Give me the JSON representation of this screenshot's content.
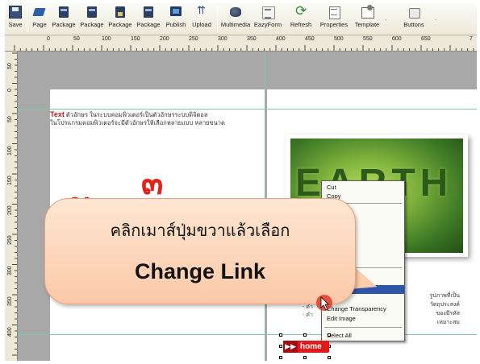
{
  "toolbar": {
    "buttons": [
      {
        "label": "Save",
        "icon": "save-icon"
      },
      {
        "label": "Page",
        "icon": "page-icon"
      },
      {
        "label": "Package",
        "icon": "package-icon"
      },
      {
        "label": "Package",
        "icon": "package-icon"
      },
      {
        "label": "Package",
        "icon": "package-lock-icon"
      },
      {
        "label": "Package",
        "icon": "package-icon"
      },
      {
        "label": "Publish",
        "icon": "publish-icon"
      },
      {
        "label": "Upload",
        "icon": "upload-icon"
      },
      {
        "label": "Multimedia",
        "icon": "multimedia-icon"
      },
      {
        "label": "EazyForm",
        "icon": "form-icon"
      },
      {
        "label": "Refresh",
        "icon": "refresh-icon"
      },
      {
        "label": "Properties",
        "icon": "properties-icon"
      },
      {
        "label": "Template",
        "icon": "template-icon"
      },
      {
        "label": "Buttons",
        "icon": "buttons-icon"
      }
    ],
    "dropdown_glyph": "."
  },
  "ruler": {
    "top_labels": [
      "0",
      "50",
      "100",
      "150",
      "200",
      "250",
      "300",
      "350",
      "400",
      "450",
      "500",
      "550",
      "600",
      "650",
      "7"
    ],
    "left_labels": [
      "50",
      "0",
      "50",
      "100",
      "150",
      "200",
      "250",
      "300",
      "350",
      "400"
    ]
  },
  "page": {
    "text_title": "Text",
    "text_line1": " ตัวอักษร ในระบบคอมพิวเตอร์เป็นตัวอักษรระบบดิจิตอล",
    "text_line2": "ในโปรแกรมคอมพิวเตอร์จะมีตัวอักษรให้เลือกหลายแบบ หลายขนาด",
    "big_char_1": "๓",
    "big_char_2": "ตั",
    "big_char_3": "ว",
    "earth_word": "EARTH",
    "right_text_1": "รูปภาพที่เป็นวัตถุประสงค์",
    "right_text_2": "ของมีรหัส",
    "right_text_3": "เหมาะสม",
    "bullet_1": "- คำ",
    "bullet_2": "- คำ",
    "home_label": "home"
  },
  "context_menu": {
    "items": [
      "Cut",
      "Copy",
      "p",
      "er",
      "layer",
      "ttom",
      "k",
      "osition",
      "Change Transparency",
      "Edit Image",
      "Select All"
    ]
  },
  "callout": {
    "line1": "คลิกเมาส์ปุ่มขวาแล้วเลือก",
    "line2": "Change Link"
  },
  "colors": {
    "accent_red": "#e2231a",
    "menu_highlight": "#2d55a8",
    "callout_fill": "#fbc9a8",
    "guide": "#7fc7a3"
  }
}
